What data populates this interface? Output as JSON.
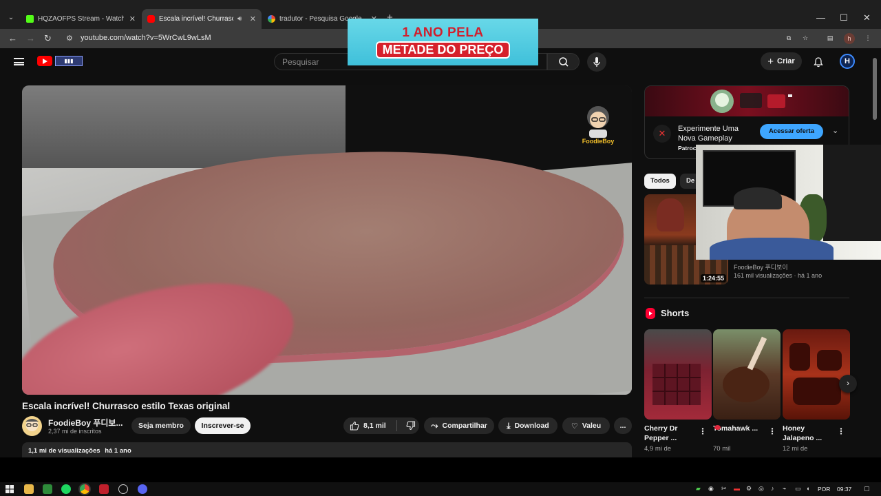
{
  "browser": {
    "tabs": [
      {
        "title": "HQZAOFPS Stream - Watch Live",
        "active": false
      },
      {
        "title": "Escala incrível! Churrasco estilo Texas original",
        "active": true
      },
      {
        "title": "tradutor - Pesquisa Google",
        "active": false
      }
    ],
    "url": "youtube.com/watch?v=5WrCwL9wLsM",
    "profile_initial": "h"
  },
  "promo": {
    "line1": "1 ANO PELA",
    "line2": "METADE DO PREÇO"
  },
  "header": {
    "search_placeholder": "Pesquisar",
    "create_label": "Criar",
    "account_initial": "H"
  },
  "video": {
    "title": "Escala incrível! Churrasco estilo Texas original",
    "channel": "FoodieBoy 푸디보...",
    "subscribers": "2,37 mi de inscritos",
    "member_label": "Seja membro",
    "subscribe_label": "Inscrever-se",
    "likes": "8,1 mil",
    "share_label": "Compartilhar",
    "download_label": "Download",
    "thanks_label": "Valeu",
    "more_label": "...",
    "views": "1,1 mi de visualizações",
    "date": "há 1 ano",
    "watermark": "FoodieBoy"
  },
  "ad": {
    "title": "Experimente Uma Nova Gameplay",
    "sponsor": "Patroc",
    "cta": "Acessar oferta"
  },
  "chips": [
    "Todos",
    "De"
  ],
  "recommendation": {
    "duration": "1:24:55",
    "channel": "FoodieBoy 푸디보이",
    "meta": "161 mil visualizações · há 1 ano"
  },
  "shorts": {
    "heading": "Shorts",
    "items": [
      {
        "title": "Cherry Dr Pepper ...",
        "views": "4,9 mi de"
      },
      {
        "title": "Tomahawk ...",
        "views": "70 mil"
      },
      {
        "title": "Honey Jalapeno ...",
        "views": "12 mi de"
      }
    ]
  },
  "taskbar": {
    "lang": "POR",
    "time": "09:37"
  },
  "colors": {
    "youtube_red": "#ff0000",
    "accent_blue": "#3ea6ff",
    "bg": "#0f0f0f"
  }
}
